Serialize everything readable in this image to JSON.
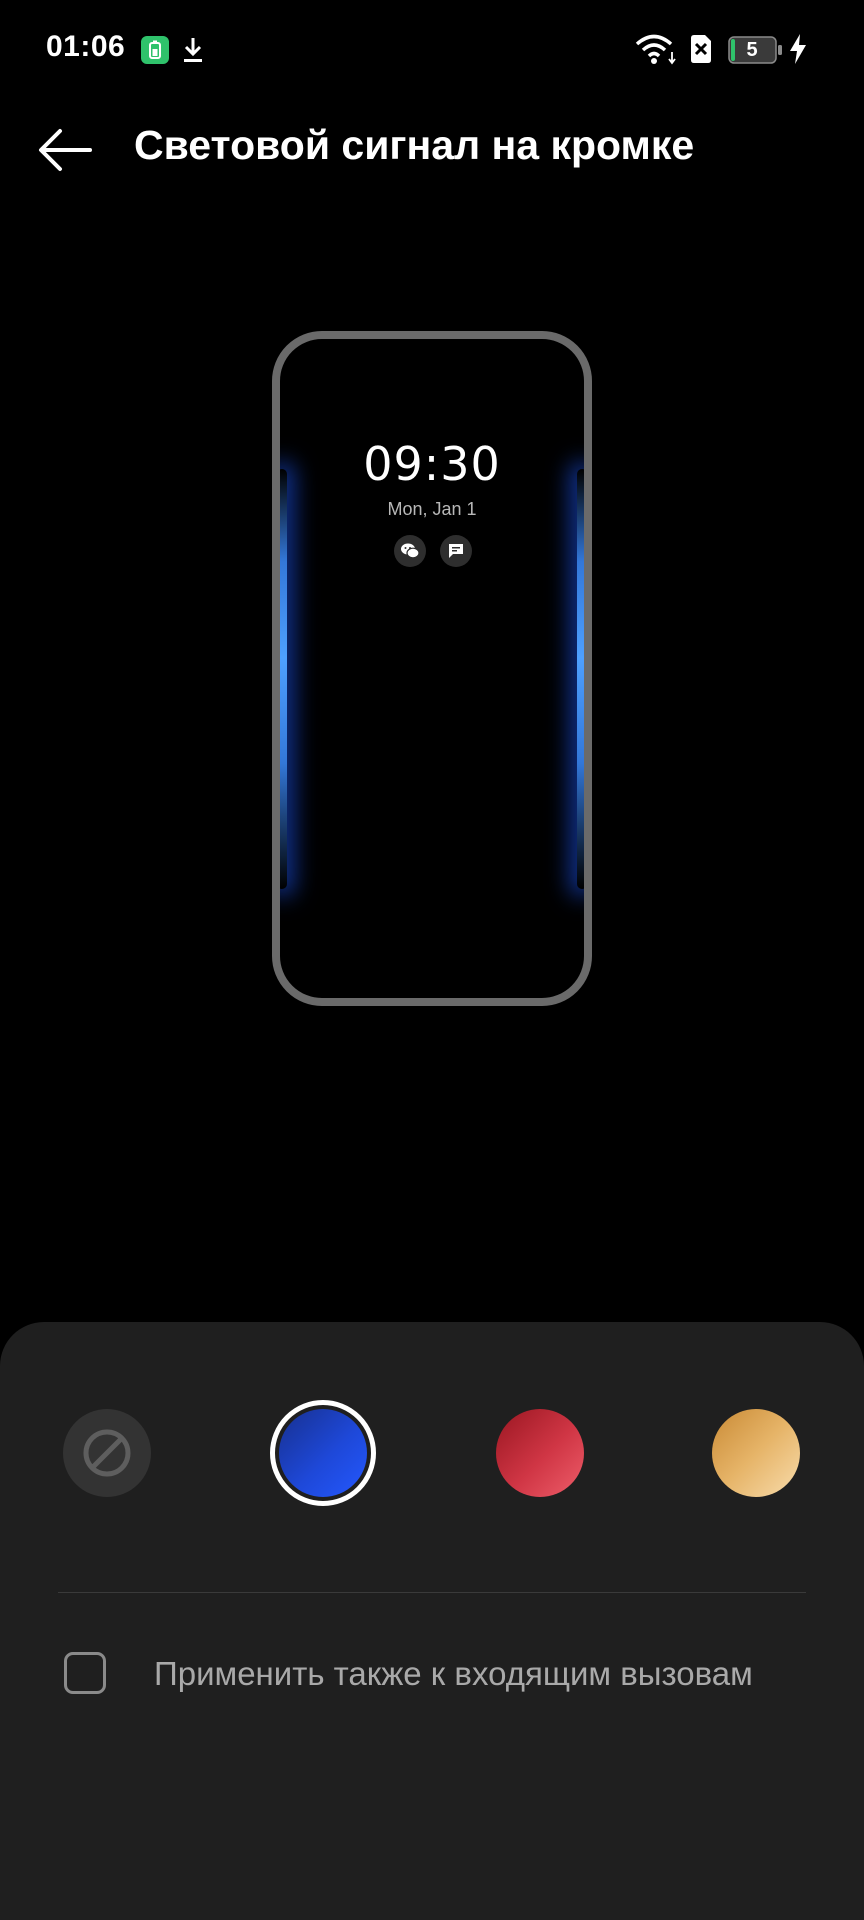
{
  "status_bar": {
    "time": "01:06",
    "battery_level": "5",
    "icons": [
      "battery-saver-icon",
      "download-icon",
      "wifi-icon",
      "no-sim-icon",
      "battery-icon",
      "charging-icon"
    ],
    "battery_saver_color": "#2fc26b"
  },
  "header": {
    "back_icon": "arrow-left-icon",
    "title": "Световой сигнал на кромке"
  },
  "preview": {
    "clock": "09:30",
    "date": "Mon, Jan 1",
    "notification_icons": [
      "wechat-icon",
      "message-icon"
    ],
    "glow_color": "#3a86ff"
  },
  "color_picker": {
    "options": [
      {
        "name": "none",
        "icon": "no-color-icon",
        "selected": false
      },
      {
        "name": "blue",
        "color": "#1e48d8",
        "selected": true
      },
      {
        "name": "red",
        "color": "#d03645",
        "selected": false
      },
      {
        "name": "gold",
        "color": "#e6b468",
        "selected": false
      }
    ]
  },
  "apply_to_calls": {
    "label": "Применить также к входящим вызовам",
    "checked": false
  }
}
